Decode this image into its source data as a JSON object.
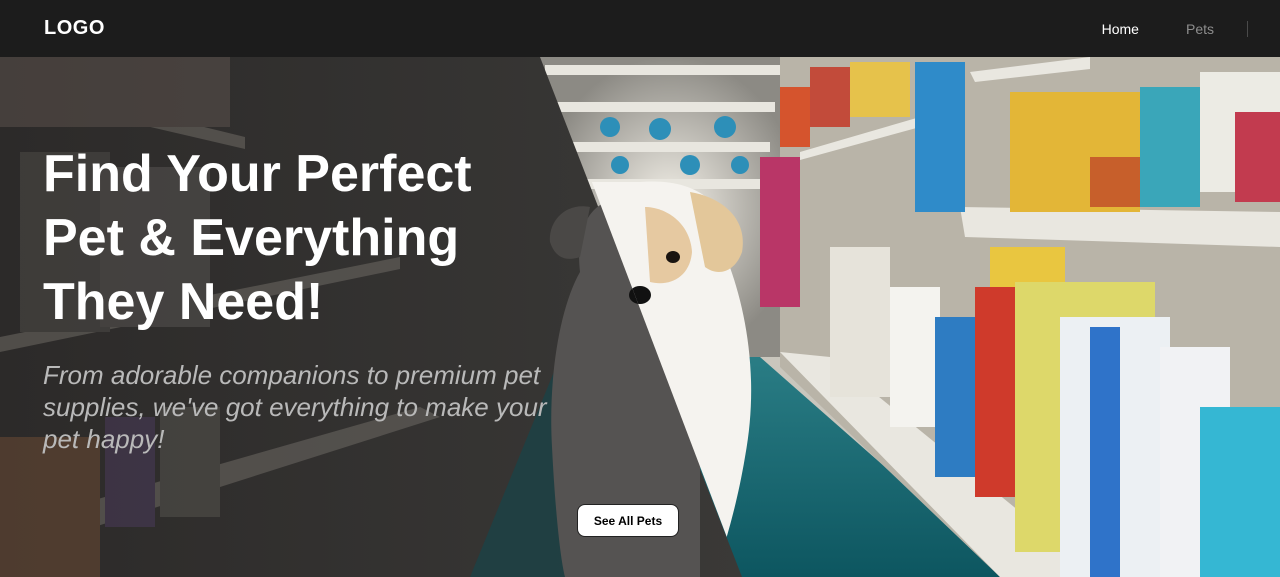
{
  "nav": {
    "logo": "LOGO",
    "links": [
      {
        "label": "Home",
        "active": true
      },
      {
        "label": "Pets",
        "active": false
      }
    ]
  },
  "hero": {
    "headline": "Find Your Perfect Pet & Everything They Need!",
    "subtext": "From adorable companions to premium pet supplies, we've got everything to make your pet happy!",
    "cta_label": "See All Pets"
  },
  "colors": {
    "nav_bg": "#1c1c1c",
    "active_link": "#ffffff",
    "inactive_link": "#8d8d8d",
    "aisle_floor": "#1f8a92"
  }
}
